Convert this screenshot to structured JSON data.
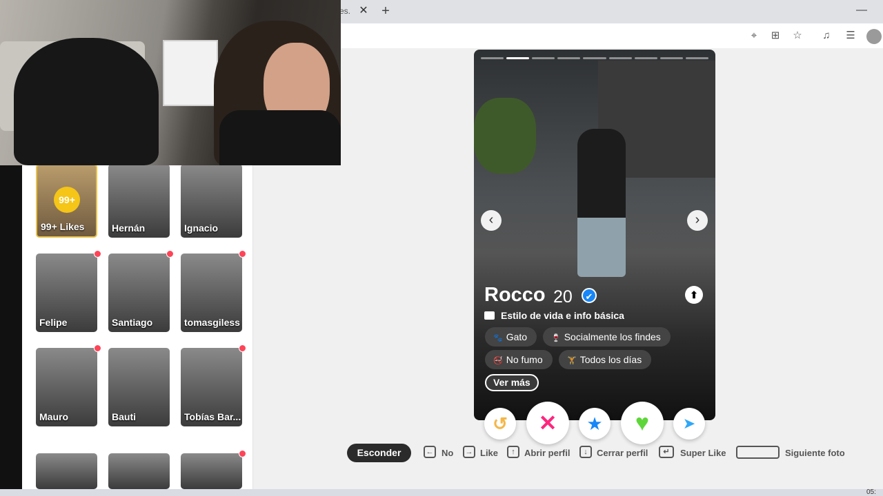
{
  "browser": {
    "tab_title": "es.",
    "tab_close": "✕",
    "new_tab": "+",
    "minimize": "—",
    "toolbar_icons": [
      "location-icon",
      "apps-icon",
      "star-icon",
      "media-icon",
      "reading-list-icon",
      "profile-icon"
    ]
  },
  "sidebar": {
    "likes_card": {
      "badge": "99+",
      "label": "99+ Likes"
    },
    "matches": [
      {
        "name": "Hernán",
        "new": false
      },
      {
        "name": "Ignacio",
        "new": false
      },
      {
        "name": "Felipe",
        "new": true
      },
      {
        "name": "Santiago",
        "new": true
      },
      {
        "name": "tomasgiless",
        "new": true
      },
      {
        "name": "Mauro",
        "new": true
      },
      {
        "name": "Bauti",
        "new": false
      },
      {
        "name": "Tobías Bar...",
        "new": true
      },
      {
        "name": "",
        "new": false
      },
      {
        "name": "",
        "new": false
      },
      {
        "name": "",
        "new": true
      }
    ]
  },
  "profile": {
    "name": "Rocco",
    "age": "20",
    "verified_icon": "✔",
    "photo_count": 9,
    "active_photo": 1,
    "prev_icon": "‹",
    "next_icon": "›",
    "expand_icon": "⬆",
    "lifestyle_label": "Estilo de vida e info básica",
    "chips": [
      {
        "icon": "paw-icon",
        "glyph": "🐾",
        "label": "Gato"
      },
      {
        "icon": "drink-icon",
        "glyph": "🍷",
        "label": "Socialmente los findes"
      },
      {
        "icon": "no-smoking-icon",
        "glyph": "🚭",
        "label": "No fumo"
      },
      {
        "icon": "dumbbell-icon",
        "glyph": "🏋",
        "label": "Todos los días"
      }
    ],
    "ver_mas": "Ver más"
  },
  "actions": {
    "rewind": "↺",
    "nope": "✕",
    "super_like": "★",
    "like": "♥",
    "boost": "➤",
    "colors": {
      "rewind": "#f5b748",
      "nope": "#fd267d",
      "super_like": "#1786f8",
      "like": "#5ed63a",
      "boost": "#2ea7f8"
    }
  },
  "shortcuts": {
    "hide": "Esconder",
    "items": [
      {
        "key": "←",
        "label": "No"
      },
      {
        "key": "→",
        "label": "Like"
      },
      {
        "key": "↑",
        "label": "Abrir perfil"
      },
      {
        "key": "↓",
        "label": "Cerrar perfil"
      },
      {
        "key": "↵",
        "label": "Super Like"
      }
    ],
    "next_photo": "Siguiente foto"
  },
  "taskbar": {
    "clock": "05:"
  }
}
